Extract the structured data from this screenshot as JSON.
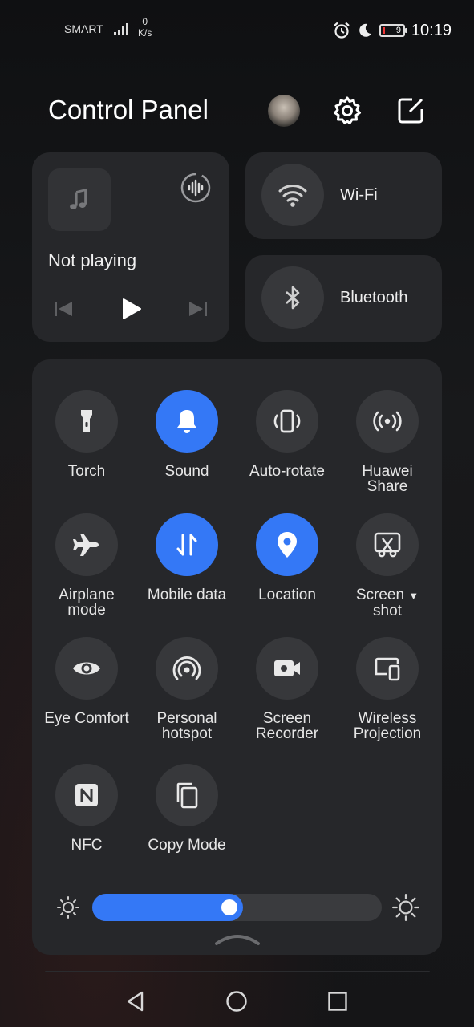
{
  "status_bar": {
    "carrier": "SMART",
    "speed_value": "0",
    "speed_unit": "K/s",
    "battery_level": "9",
    "time": "10:19",
    "icons": [
      "signal-icon",
      "alarm-icon",
      "moon-icon",
      "battery-icon"
    ]
  },
  "header": {
    "title": "Control Panel",
    "icons": [
      "avatar",
      "settings-icon",
      "edit-icon"
    ]
  },
  "media": {
    "status": "Not playing",
    "icons": [
      "music-note-icon",
      "audio-output-icon",
      "previous-icon",
      "play-icon",
      "next-icon"
    ]
  },
  "tiles": {
    "wifi": "Wi-Fi",
    "bluetooth": "Bluetooth"
  },
  "toggles": [
    {
      "label": "Torch",
      "icon": "torch-icon",
      "on": false
    },
    {
      "label": "Sound",
      "icon": "bell-icon",
      "on": true
    },
    {
      "label": "Auto-rotate",
      "icon": "auto-rotate-icon",
      "on": false
    },
    {
      "label": "Huawei Share",
      "icon": "huawei-share-icon",
      "on": false
    },
    {
      "label": "Airplane mode",
      "icon": "airplane-icon",
      "on": false
    },
    {
      "label": "Mobile data",
      "icon": "mobile-data-icon",
      "on": true
    },
    {
      "label": "Location",
      "icon": "location-icon",
      "on": true
    },
    {
      "label": "Screen shot",
      "icon": "screenshot-icon",
      "on": false
    },
    {
      "label": "Eye Comfort",
      "icon": "eye-icon",
      "on": false
    },
    {
      "label": "Personal hotspot",
      "icon": "hotspot-icon",
      "on": false
    },
    {
      "label": "Screen Recorder",
      "icon": "screen-recorder-icon",
      "on": false
    },
    {
      "label": "Wireless Projection",
      "icon": "wireless-projection-icon",
      "on": false
    },
    {
      "label": "NFC",
      "icon": "nfc-icon",
      "on": false
    },
    {
      "label": "Copy Mode",
      "icon": "copy-icon",
      "on": false
    }
  ],
  "brightness": {
    "level": 0.52
  },
  "colors": {
    "accent": "#3478f6",
    "panel": "#26272a",
    "button": "#37383b"
  },
  "navbar": {
    "icons": [
      "back-icon",
      "home-icon",
      "recents-icon"
    ]
  }
}
